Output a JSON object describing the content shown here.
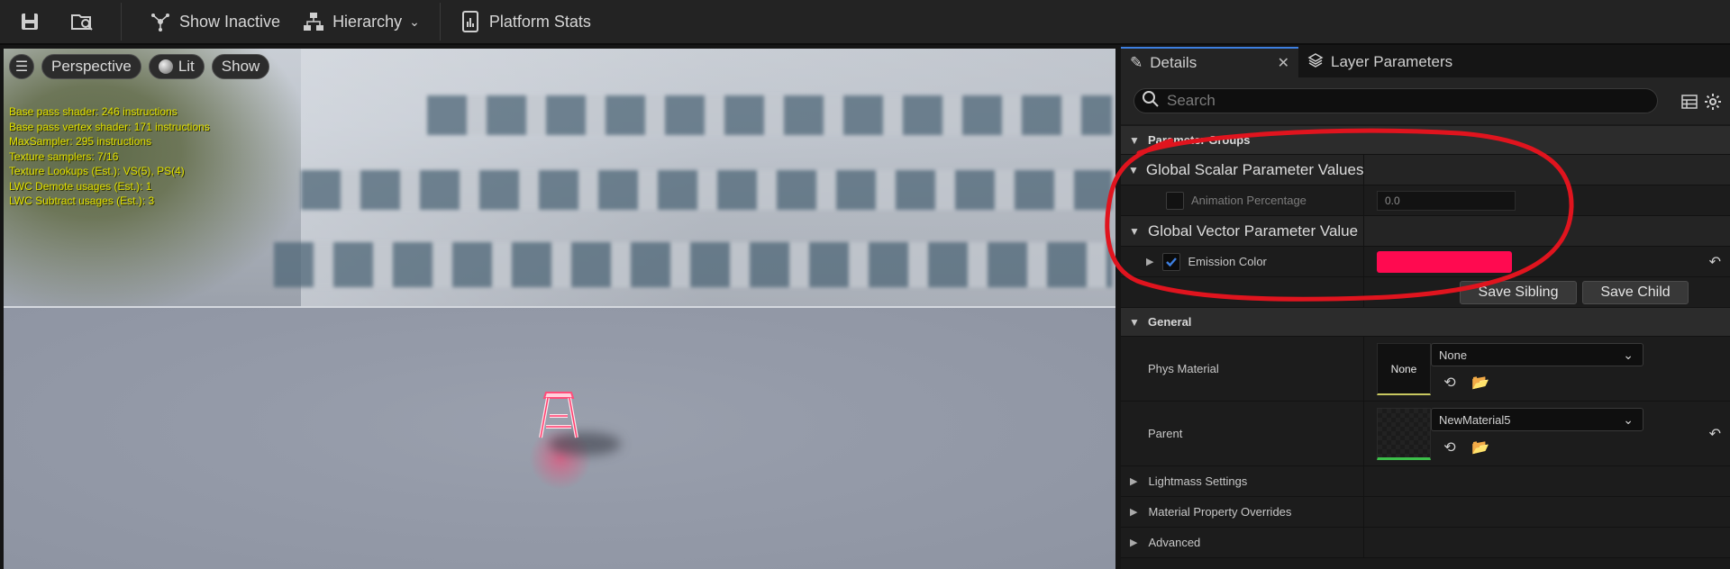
{
  "toolbar": {
    "show_inactive": "Show Inactive",
    "hierarchy": "Hierarchy",
    "platform_stats": "Platform Stats"
  },
  "viewport": {
    "perspective": "Perspective",
    "lit": "Lit",
    "show": "Show",
    "stats": [
      "Base pass shader: 246 instructions",
      "Base pass vertex shader: 171 instructions",
      "MaxSampler: 295 instructions",
      "Texture samplers: 7/16",
      "Texture Lookups (Est.): VS(5), PS(4)",
      "LWC Demote usages (Est.): 1",
      "LWC Subtract usages (Est.): 3"
    ]
  },
  "details": {
    "tabs": [
      "Details",
      "Layer Parameters"
    ],
    "search_placeholder": "Search",
    "parameter_groups": "Parameter Groups",
    "scalar_group": "Global Scalar Parameter Values",
    "animation_percentage": "Animation Percentage",
    "animation_value": "0.0",
    "vector_group": "Global Vector Parameter Value",
    "emission_color": "Emission Color",
    "emission_hex": "#FF0A50",
    "save_sibling": "Save Sibling",
    "save_child": "Save Child",
    "general": "General",
    "phys_material": "Phys Material",
    "phys_thumb": "None",
    "phys_value": "None",
    "parent": "Parent",
    "parent_value": "NewMaterial5",
    "lightmass": "Lightmass Settings",
    "material_overrides": "Material Property Overrides",
    "advanced": "Advanced"
  },
  "colors": {
    "accent": "#3d7fe0",
    "annotation": "#e0141e",
    "stats_text": "#e0e000"
  }
}
